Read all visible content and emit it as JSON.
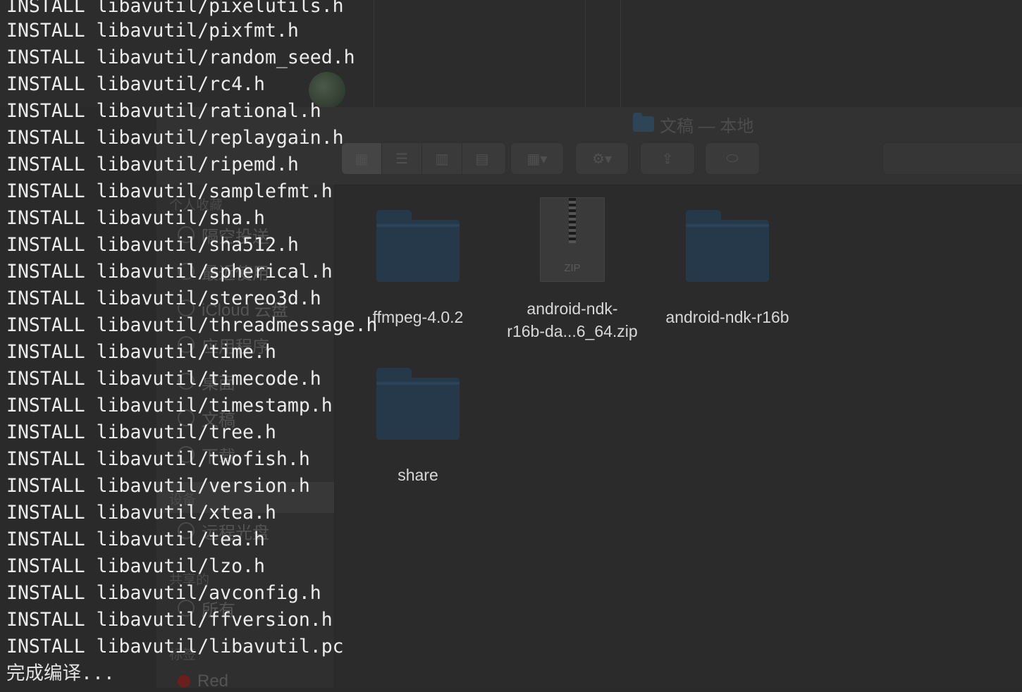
{
  "terminal": {
    "lines": [
      "INSTALL libavutil/pixelutils.h",
      "INSTALL libavutil/pixfmt.h",
      "INSTALL libavutil/random_seed.h",
      "INSTALL libavutil/rc4.h",
      "INSTALL libavutil/rational.h",
      "INSTALL libavutil/replaygain.h",
      "INSTALL libavutil/ripemd.h",
      "INSTALL libavutil/samplefmt.h",
      "INSTALL libavutil/sha.h",
      "INSTALL libavutil/sha512.h",
      "INSTALL libavutil/spherical.h",
      "INSTALL libavutil/stereo3d.h",
      "INSTALL libavutil/threadmessage.h",
      "INSTALL libavutil/time.h",
      "INSTALL libavutil/timecode.h",
      "INSTALL libavutil/timestamp.h",
      "INSTALL libavutil/tree.h",
      "INSTALL libavutil/twofish.h",
      "INSTALL libavutil/version.h",
      "INSTALL libavutil/xtea.h",
      "INSTALL libavutil/tea.h",
      "INSTALL libavutil/lzo.h",
      "INSTALL libavutil/avconfig.h",
      "INSTALL libavutil/ffversion.h",
      "INSTALL libavutil/libavutil.pc"
    ],
    "status": "完成编译..."
  },
  "finder": {
    "title": "文稿 — 本地",
    "sidebar": {
      "sections": {
        "favorites": "个人收藏",
        "devices": "设备",
        "shared": "共享的",
        "tags": "标签"
      },
      "items": {
        "airdrop": "隔空投送",
        "recents": "最近使用",
        "icloud": "iCloud 云盘",
        "applications": "应用程序",
        "desktop": "桌面",
        "documents": "文稿",
        "downloads": "下载",
        "remote_disc": "远程光盘",
        "all": "所有",
        "red": "Red"
      }
    },
    "files": [
      {
        "name": "ffmpeg-4.0.2",
        "kind": "folder"
      },
      {
        "name_line1": "android-ndk-",
        "name_line2": "r16b-da...6_64.zip",
        "kind": "zip",
        "badge": "ZIP"
      },
      {
        "name": "android-ndk-r16b",
        "kind": "folder"
      },
      {
        "name": "share",
        "kind": "folder"
      }
    ]
  },
  "colors": {
    "terminal_text": "#ececec",
    "background": "#2a2a2a",
    "folder_blue": "#25394a"
  }
}
